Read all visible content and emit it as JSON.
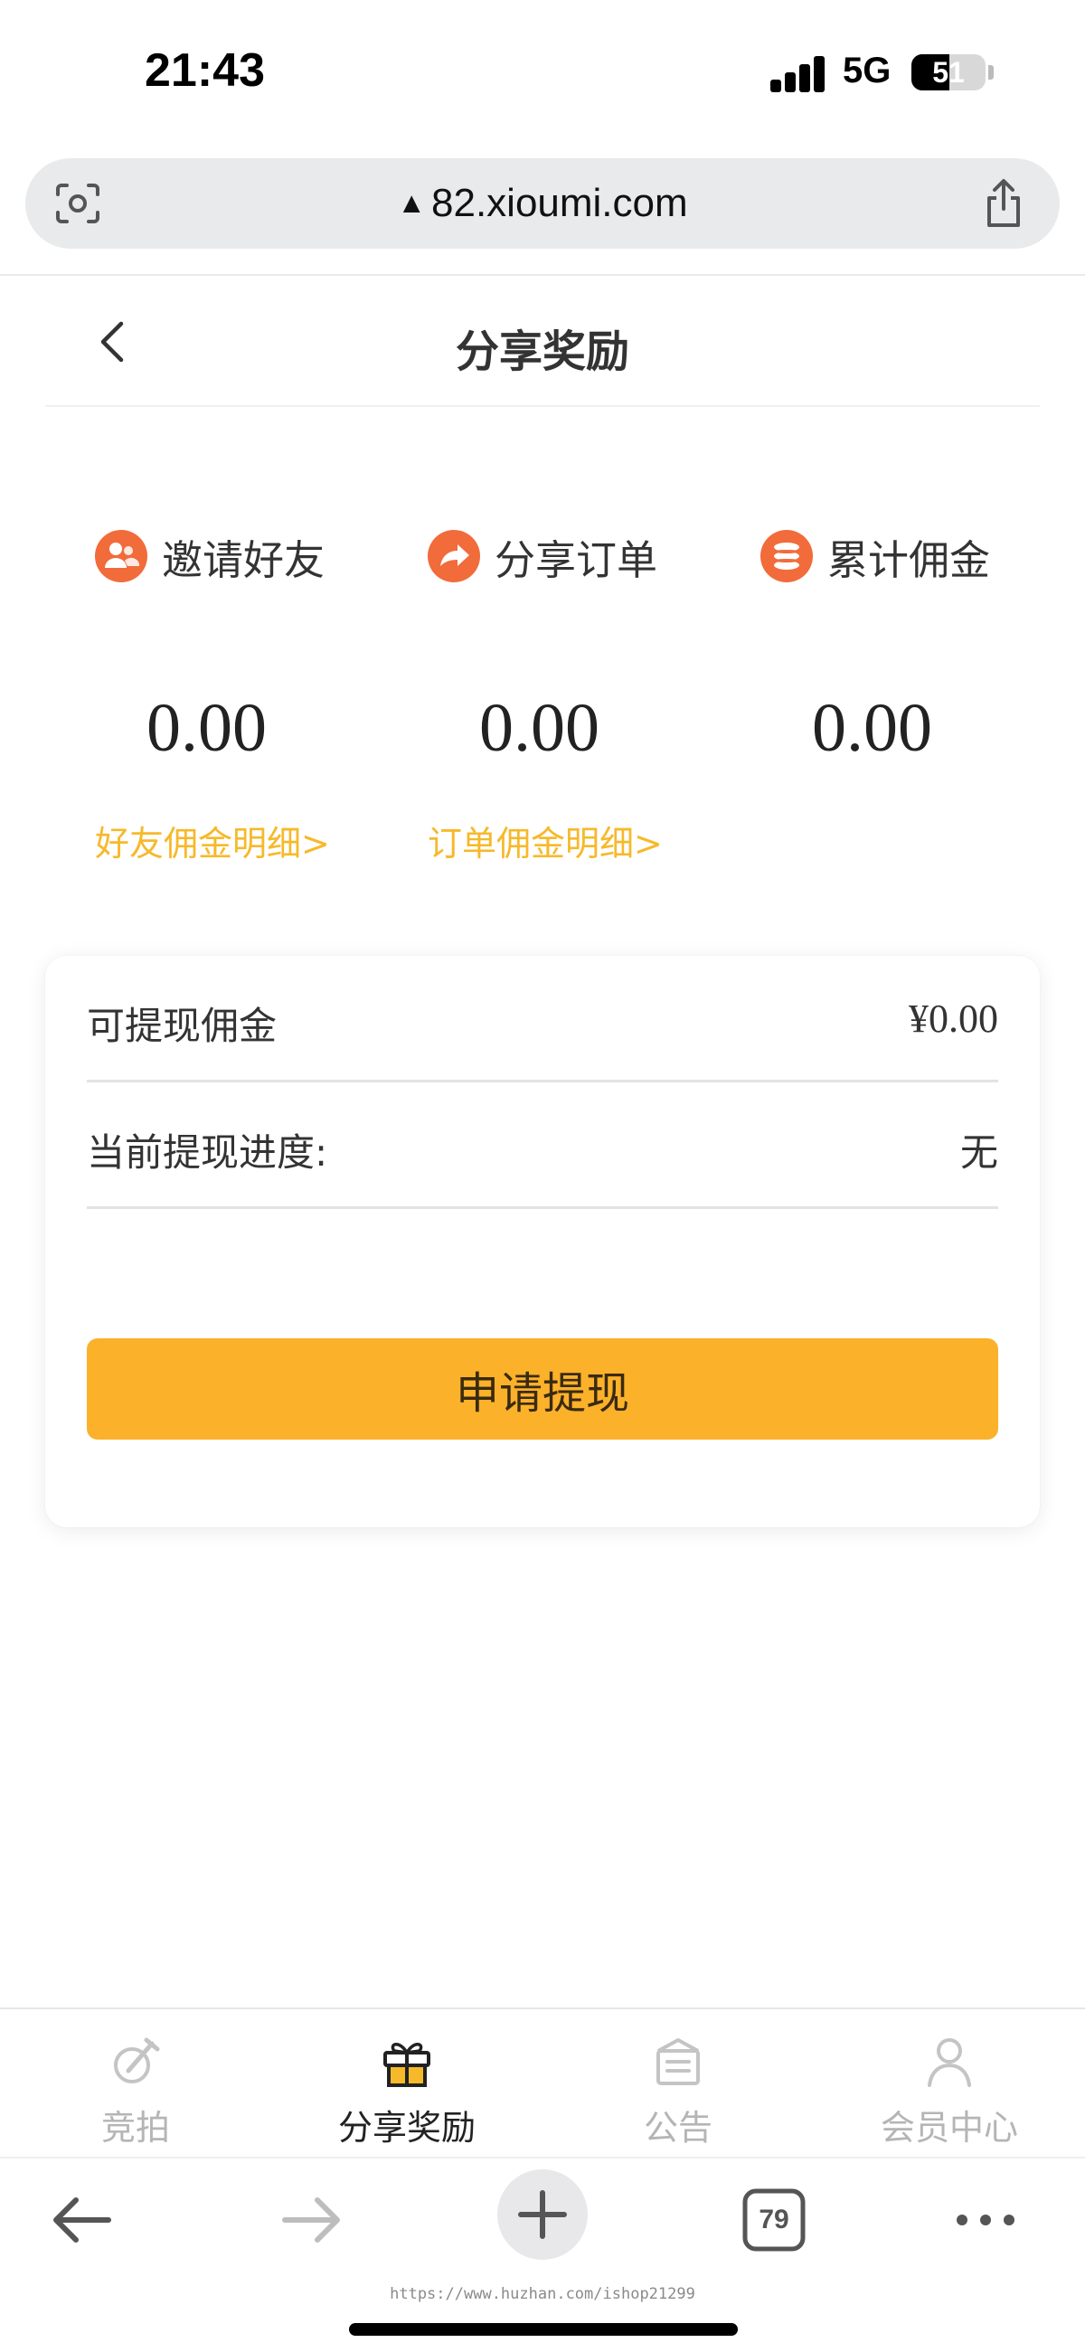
{
  "status_bar": {
    "time": "21:43",
    "network": "5G",
    "battery": "51"
  },
  "browser": {
    "url_warning": "▲",
    "url": "82.xioumi.com",
    "tab_count": "79",
    "watermark": "https://www.huzhan.com/ishop21299"
  },
  "header": {
    "title": "分享奖励"
  },
  "stats": [
    {
      "label": "邀请好友",
      "value": "0.00",
      "link": "好友佣金明细>",
      "icon": "friends-icon",
      "color": "#f26b3a"
    },
    {
      "label": "分享订单",
      "value": "0.00",
      "link": "订单佣金明细>",
      "icon": "share-arrow-icon",
      "color": "#f26b3a"
    },
    {
      "label": "累计佣金",
      "value": "0.00",
      "link": "",
      "icon": "coins-icon",
      "color": "#f26b3a"
    }
  ],
  "withdraw": {
    "available_label": "可提现佣金",
    "available_value": "¥0.00",
    "progress_label": "当前提现进度:",
    "progress_value": "无",
    "button_label": "申请提现",
    "button_color": "#fbb12a"
  },
  "tabs": [
    {
      "label": "竞拍",
      "icon": "auction-icon",
      "active": false
    },
    {
      "label": "分享奖励",
      "icon": "gift-icon",
      "active": true
    },
    {
      "label": "公告",
      "icon": "notice-icon",
      "active": false
    },
    {
      "label": "会员中心",
      "icon": "user-icon",
      "active": false
    }
  ],
  "colors": {
    "accent": "#f6b92a",
    "icon_orange": "#f26b3a"
  }
}
